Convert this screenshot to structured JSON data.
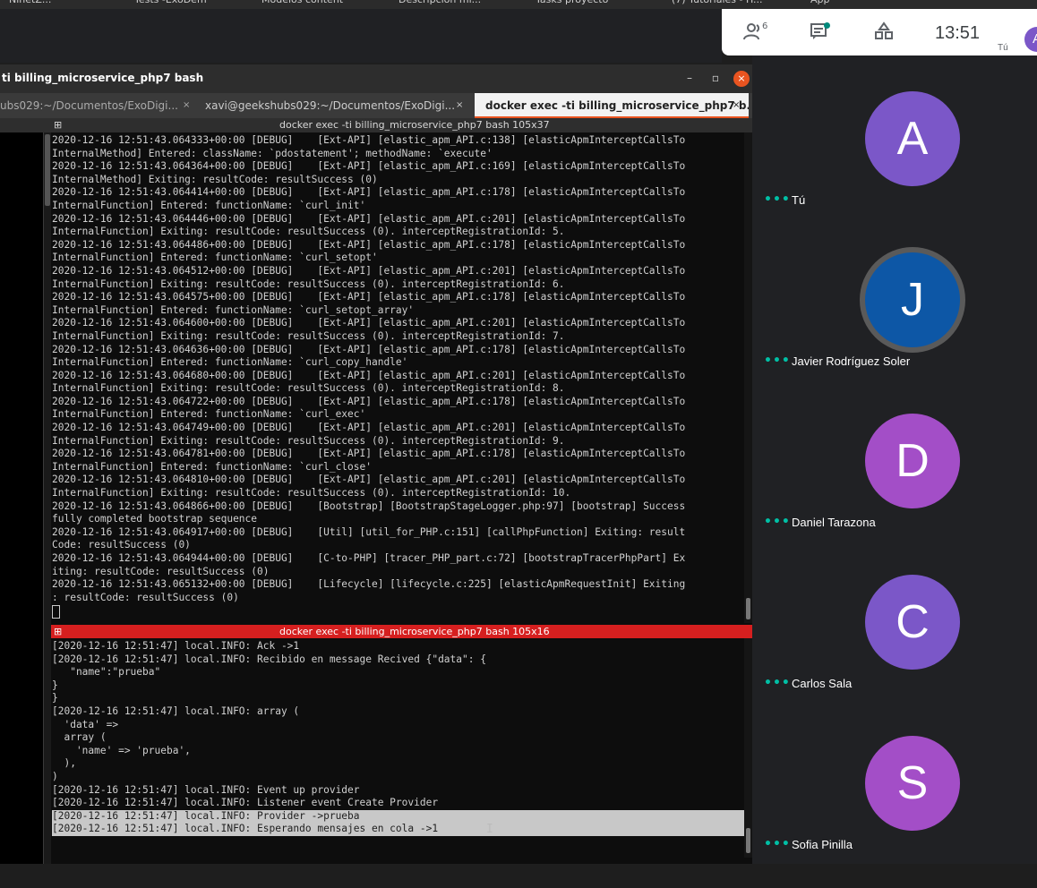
{
  "bookmarks": [
    {
      "label": "NinetZ..."
    },
    {
      "label": "Tests -ExoDem"
    },
    {
      "label": "Modelos content"
    },
    {
      "label": "Descripcion mi..."
    },
    {
      "label": "Tasks proyecto"
    },
    {
      "label": "(7) Tutoriales - H..."
    },
    {
      "label": "App"
    }
  ],
  "meet": {
    "participants_icon": "people-icon",
    "participants_count": "6",
    "chat_icon": "chat-icon",
    "activities_icon": "shapes-icon",
    "clock": "13:51",
    "self_label": "Tú",
    "self_initial": "A",
    "participants": [
      {
        "initial": "A",
        "name": "Tú",
        "color": "#7b57c8",
        "speaking": false
      },
      {
        "initial": "J",
        "name": "Javier Rodríguez Soler",
        "color": "#0d57a6",
        "speaking": true
      },
      {
        "initial": "D",
        "name": "Daniel Tarazona",
        "color": "#a34ec7",
        "speaking": false
      },
      {
        "initial": "C",
        "name": "Carlos Sala",
        "color": "#7b57c8",
        "speaking": false
      },
      {
        "initial": "S",
        "name": "Sofia Pinilla",
        "color": "#a34ec7",
        "speaking": false
      }
    ],
    "more_options_glyph": "•••"
  },
  "terminal": {
    "window_title": "ti billing_microservice_php7 bash",
    "controls": {
      "minimize": "–",
      "maximize": "▫",
      "close": "×"
    },
    "tabs": [
      {
        "label": "ubs029:~/Documentos/ExoDigi...",
        "active": false
      },
      {
        "label": "xavi@geekshubs029:~/Documentos/ExoDigi...",
        "active": false
      },
      {
        "label": "docker exec -ti billing_microservice_php7 b...",
        "active": true
      }
    ],
    "tab_close_glyph": "×",
    "top_pane": {
      "header": "docker exec -ti billing_microservice_php7 bash 105x37",
      "lines": [
        "2020-12-16 12:51:43.064333+00:00 [DEBUG]    [Ext-API] [elastic_apm_API.c:138] [elasticApmInterceptCallsTo",
        "InternalMethod] Entered: className: `pdostatement'; methodName: `execute'",
        "2020-12-16 12:51:43.064364+00:00 [DEBUG]    [Ext-API] [elastic_apm_API.c:169] [elasticApmInterceptCallsTo",
        "InternalMethod] Exiting: resultCode: resultSuccess (0)",
        "2020-12-16 12:51:43.064414+00:00 [DEBUG]    [Ext-API] [elastic_apm_API.c:178] [elasticApmInterceptCallsTo",
        "InternalFunction] Entered: functionName: `curl_init'",
        "2020-12-16 12:51:43.064446+00:00 [DEBUG]    [Ext-API] [elastic_apm_API.c:201] [elasticApmInterceptCallsTo",
        "InternalFunction] Exiting: resultCode: resultSuccess (0). interceptRegistrationId: 5.",
        "2020-12-16 12:51:43.064486+00:00 [DEBUG]    [Ext-API] [elastic_apm_API.c:178] [elasticApmInterceptCallsTo",
        "InternalFunction] Entered: functionName: `curl_setopt'",
        "2020-12-16 12:51:43.064512+00:00 [DEBUG]    [Ext-API] [elastic_apm_API.c:201] [elasticApmInterceptCallsTo",
        "InternalFunction] Exiting: resultCode: resultSuccess (0). interceptRegistrationId: 6.",
        "2020-12-16 12:51:43.064575+00:00 [DEBUG]    [Ext-API] [elastic_apm_API.c:178] [elasticApmInterceptCallsTo",
        "InternalFunction] Entered: functionName: `curl_setopt_array'",
        "2020-12-16 12:51:43.064600+00:00 [DEBUG]    [Ext-API] [elastic_apm_API.c:201] [elasticApmInterceptCallsTo",
        "InternalFunction] Exiting: resultCode: resultSuccess (0). interceptRegistrationId: 7.",
        "2020-12-16 12:51:43.064636+00:00 [DEBUG]    [Ext-API] [elastic_apm_API.c:178] [elasticApmInterceptCallsTo",
        "InternalFunction] Entered: functionName: `curl_copy_handle'",
        "2020-12-16 12:51:43.064680+00:00 [DEBUG]    [Ext-API] [elastic_apm_API.c:201] [elasticApmInterceptCallsTo",
        "InternalFunction] Exiting: resultCode: resultSuccess (0). interceptRegistrationId: 8.",
        "2020-12-16 12:51:43.064722+00:00 [DEBUG]    [Ext-API] [elastic_apm_API.c:178] [elasticApmInterceptCallsTo",
        "InternalFunction] Entered: functionName: `curl_exec'",
        "2020-12-16 12:51:43.064749+00:00 [DEBUG]    [Ext-API] [elastic_apm_API.c:201] [elasticApmInterceptCallsTo",
        "InternalFunction] Exiting: resultCode: resultSuccess (0). interceptRegistrationId: 9.",
        "2020-12-16 12:51:43.064781+00:00 [DEBUG]    [Ext-API] [elastic_apm_API.c:178] [elasticApmInterceptCallsTo",
        "InternalFunction] Entered: functionName: `curl_close'",
        "2020-12-16 12:51:43.064810+00:00 [DEBUG]    [Ext-API] [elastic_apm_API.c:201] [elasticApmInterceptCallsTo",
        "InternalFunction] Exiting: resultCode: resultSuccess (0). interceptRegistrationId: 10.",
        "2020-12-16 12:51:43.064866+00:00 [DEBUG]    [Bootstrap] [BootstrapStageLogger.php:97] [bootstrap] Success",
        "fully completed bootstrap sequence",
        "2020-12-16 12:51:43.064917+00:00 [DEBUG]    [Util] [util_for_PHP.c:151] [callPhpFunction] Exiting: result",
        "Code: resultSuccess (0)",
        "2020-12-16 12:51:43.064944+00:00 [DEBUG]    [C-to-PHP] [tracer_PHP_part.c:72] [bootstrapTracerPhpPart] Ex",
        "iting: resultCode: resultSuccess (0)",
        "2020-12-16 12:51:43.065132+00:00 [DEBUG]    [Lifecycle] [lifecycle.c:225] [elasticApmRequestInit] Exiting",
        ": resultCode: resultSuccess (0)"
      ]
    },
    "bottom_pane": {
      "header": "docker exec -ti billing_microservice_php7 bash 105x16",
      "lines": [
        "[2020-12-16 12:51:47] local.INFO: Ack ->1",
        "[2020-12-16 12:51:47] local.INFO: Recibido en message Recived {\"data\": {",
        "   \"name\":\"prueba\"",
        "}",
        "}",
        "[2020-12-16 12:51:47] local.INFO: array (",
        "  'data' =>",
        "  array (",
        "    'name' => 'prueba',",
        "  ),",
        ")",
        "[2020-12-16 12:51:47] local.INFO: Event up provider",
        "[2020-12-16 12:51:47] local.INFO: Listener event Create Provider",
        "[2020-12-16 12:51:47] local.INFO: Provider ->prueba",
        "[2020-12-16 12:51:47] local.INFO: Esperando mensajes en cola ->1"
      ],
      "highlighted_from": 13
    }
  },
  "colors": {
    "ubuntu_orange": "#e95420",
    "active_pane_red": "#d61f1f",
    "meet_teal": "#00bfa5"
  }
}
